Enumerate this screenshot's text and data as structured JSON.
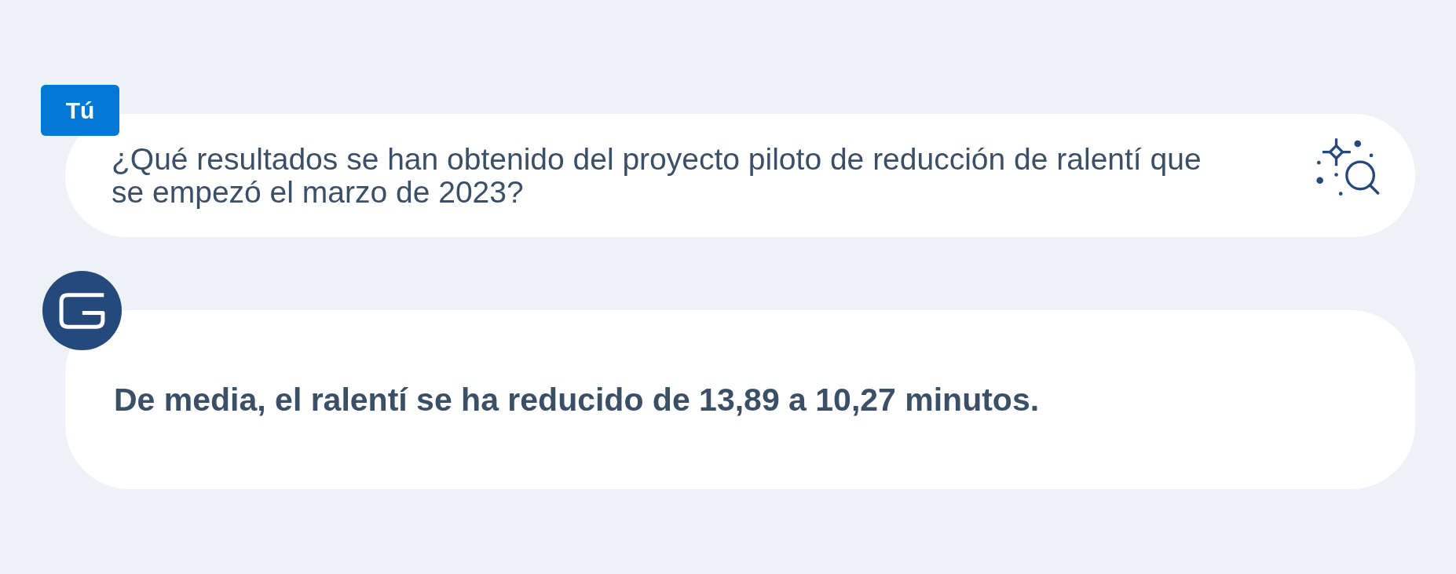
{
  "user_message": {
    "sender": "Tú",
    "text": "¿Qué resultados se han obtenido del proyecto piloto de reducción de ralentí que se empezó el marzo de 2023?"
  },
  "assistant_message": {
    "text": "De media, el ralentí se ha reducido de 13,89 a 10,27 minutos."
  }
}
